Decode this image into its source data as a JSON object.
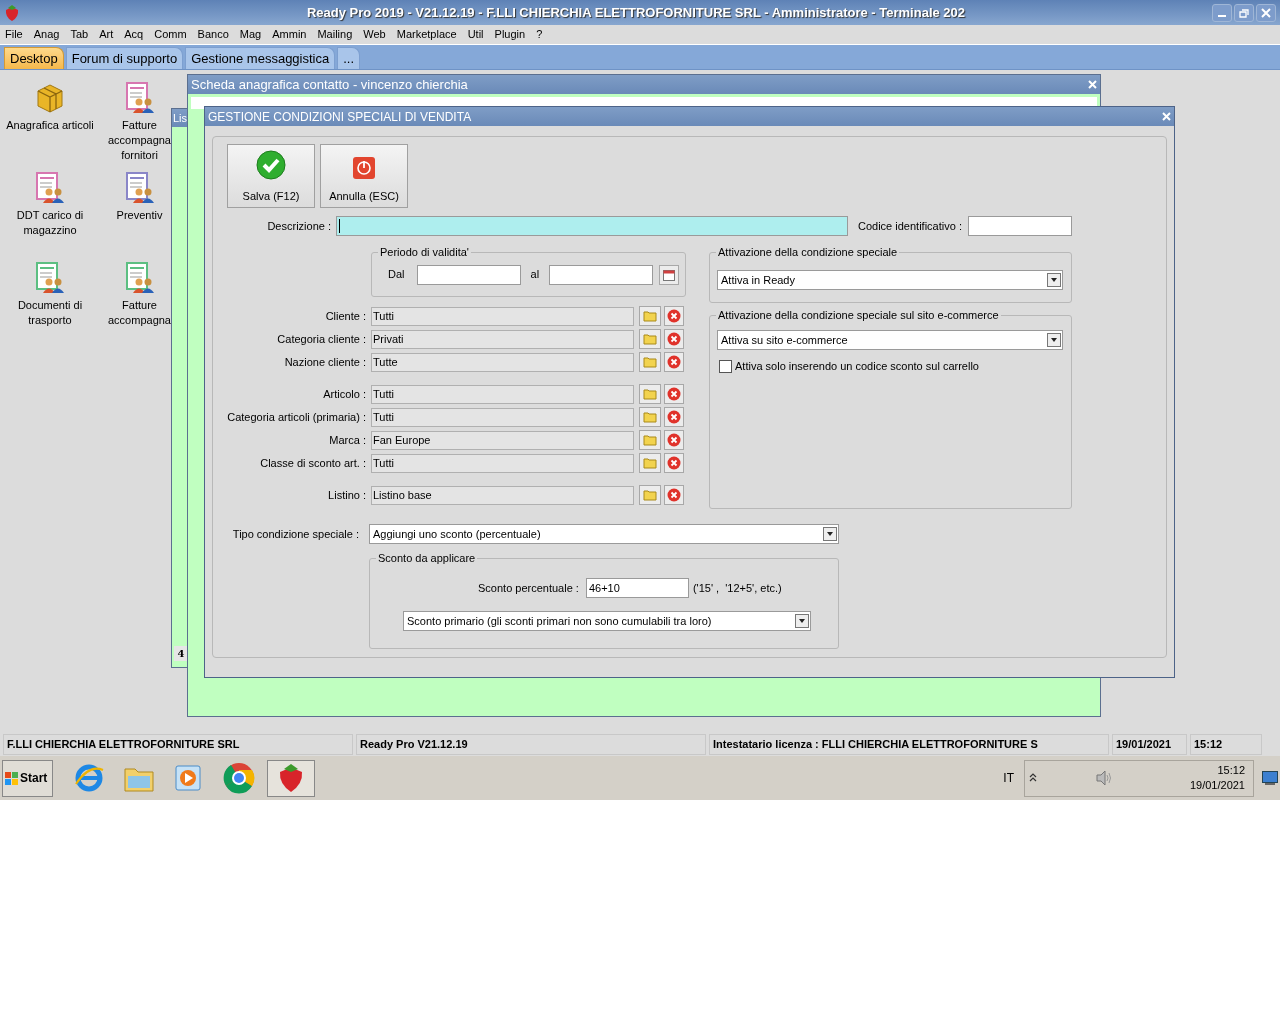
{
  "window": {
    "title": "Ready Pro 2019 - V21.12.19 - F.LLI CHIERCHIA ELETTROFORNITURE SRL - Amministratore - Terminale 202"
  },
  "menu": [
    "File",
    "Anag",
    "Tab",
    "Art",
    "Acq",
    "Comm",
    "Banco",
    "Mag",
    "Ammin",
    "Mailing",
    "Web",
    "Marketplace",
    "Util",
    "Plugin",
    "?"
  ],
  "tabs": [
    {
      "label": "Desktop",
      "selected": true
    },
    {
      "label": "Forum di supporto",
      "selected": false
    },
    {
      "label": "Gestione messaggistica",
      "selected": false
    },
    {
      "label": "...",
      "selected": false
    }
  ],
  "desktop_icons": [
    {
      "kind": "box",
      "lines": [
        "Anagrafica articoli"
      ]
    },
    {
      "kind": "invoice",
      "lines": [
        "Fatture",
        "accompagna",
        "fornitori"
      ]
    },
    {
      "kind": "invoice",
      "lines": [
        "DDT carico di",
        "magazzino"
      ]
    },
    {
      "kind": "quote",
      "lines": [
        "Preventiv"
      ]
    },
    {
      "kind": "transport",
      "lines": [
        "Documenti di",
        "trasporto"
      ]
    },
    {
      "kind": "transport",
      "lines": [
        "Fatture",
        "accompagna"
      ]
    }
  ],
  "background_windows": {
    "list": {
      "title": "Lis",
      "footer": "4"
    },
    "contact": {
      "title": "Scheda anagrafica contatto - vincenzo chierchia"
    }
  },
  "dialog": {
    "title": "GESTIONE CONDIZIONI SPECIALI DI VENDITA",
    "buttons": [
      {
        "kind": "save",
        "label": "Salva (F12)"
      },
      {
        "kind": "cancel",
        "label": "Annulla (ESC)"
      }
    ],
    "description": {
      "label": "Descrizione :",
      "focused": true
    },
    "code": {
      "label": "Codice identificativo :"
    },
    "validity": {
      "title": "Periodo di validita'",
      "from_label": "Dal",
      "to_label": "al"
    },
    "filter_groups": [
      [
        {
          "label": "Cliente :",
          "value": "Tutti"
        },
        {
          "label": "Categoria cliente :",
          "value": "Privati"
        },
        {
          "label": "Nazione cliente :",
          "value": "Tutte"
        }
      ],
      [
        {
          "label": "Articolo :",
          "value": "Tutti"
        },
        {
          "label": "Categoria articoli (primaria) :",
          "value": "Tutti"
        },
        {
          "label": "Marca :",
          "value": "Fan Europe"
        },
        {
          "label": "Classe di sconto art. :",
          "value": "Tutti"
        }
      ],
      [
        {
          "label": "Listino :",
          "value": "Listino base"
        }
      ]
    ],
    "activation": {
      "title": "Attivazione della condizione speciale",
      "value": "Attiva in Ready"
    },
    "ecommerce": {
      "title": "Attivazione della condizione speciale sul sito e-commerce",
      "value": "Attiva su sito e-commerce",
      "checkbox": {
        "label": "Attiva solo inserendo un codice sconto sul carrello",
        "checked": false
      }
    },
    "type": {
      "label": "Tipo condizione speciale :",
      "value": "Aggiungi uno sconto (percentuale)"
    },
    "discount": {
      "title": "Sconto da applicare",
      "label": "Sconto percentuale :",
      "value": "46+10",
      "hint": "('15' ,  '12+5', etc.)",
      "mode": "Sconto primario (gli sconti primari non sono cumulabili tra loro)"
    }
  },
  "status_bar": [
    "F.LLI CHIERCHIA ELETTROFORNITURE SRL",
    "Ready Pro V21.12.19",
    "Intestatario licenza : FLLI CHIERCHIA ELETTROFORNITURE S",
    "19/01/2021",
    "15:12"
  ],
  "taskbar": {
    "start": "Start",
    "language": "IT",
    "time": "15:12",
    "date": "19/01/2021"
  }
}
